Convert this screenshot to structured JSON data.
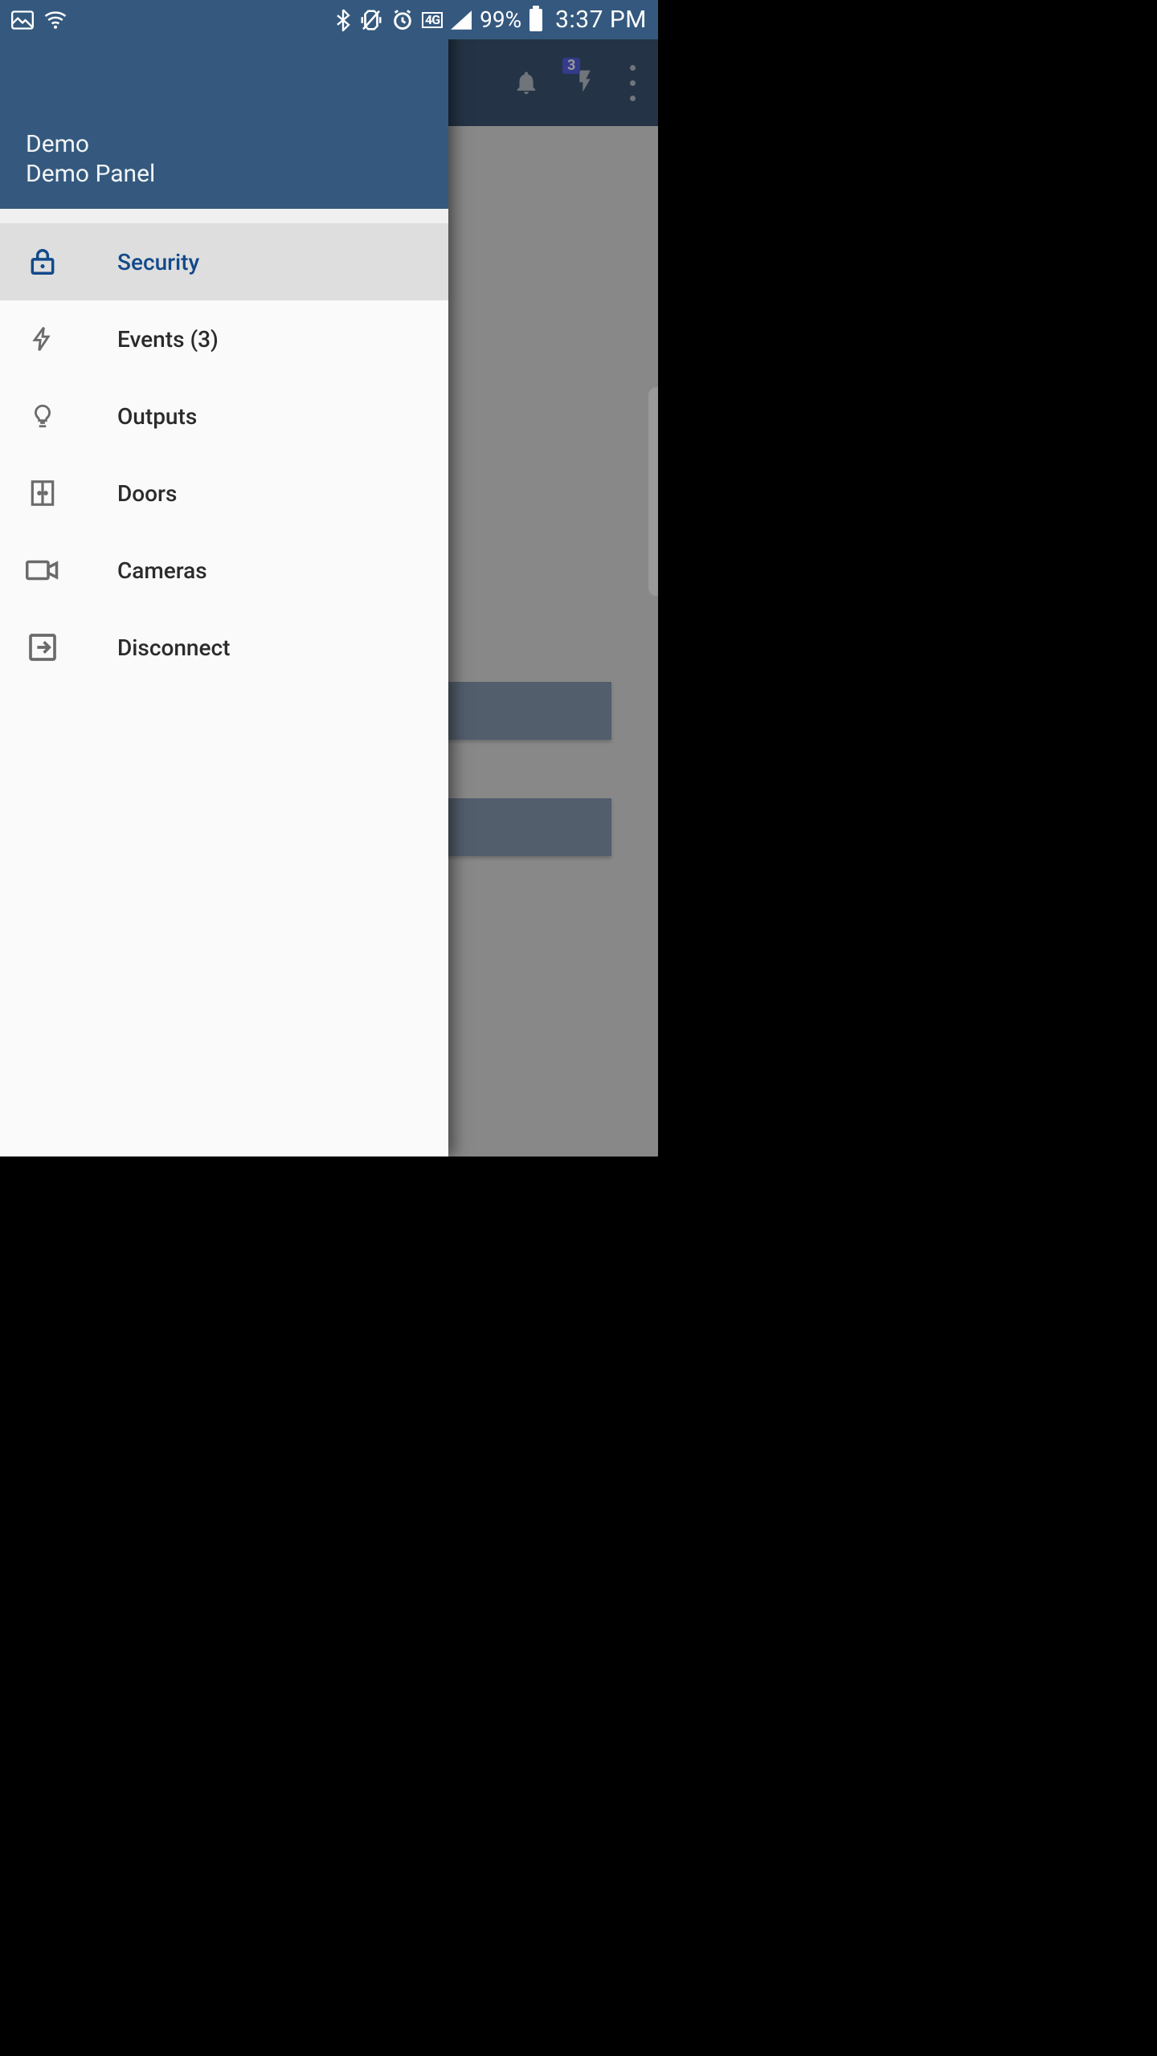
{
  "statusbar": {
    "battery_pct": "99%",
    "clock": "3:37 PM",
    "network_label": "4G"
  },
  "appbar": {
    "notifications_badge": "3"
  },
  "drawer": {
    "header": {
      "account": "Demo",
      "panel": "Demo Panel"
    },
    "items": [
      {
        "label": "Security",
        "active": true
      },
      {
        "label": "Events (3)",
        "active": false
      },
      {
        "label": "Outputs",
        "active": false
      },
      {
        "label": "Doors",
        "active": false
      },
      {
        "label": "Cameras",
        "active": false
      },
      {
        "label": "Disconnect",
        "active": false
      }
    ]
  }
}
